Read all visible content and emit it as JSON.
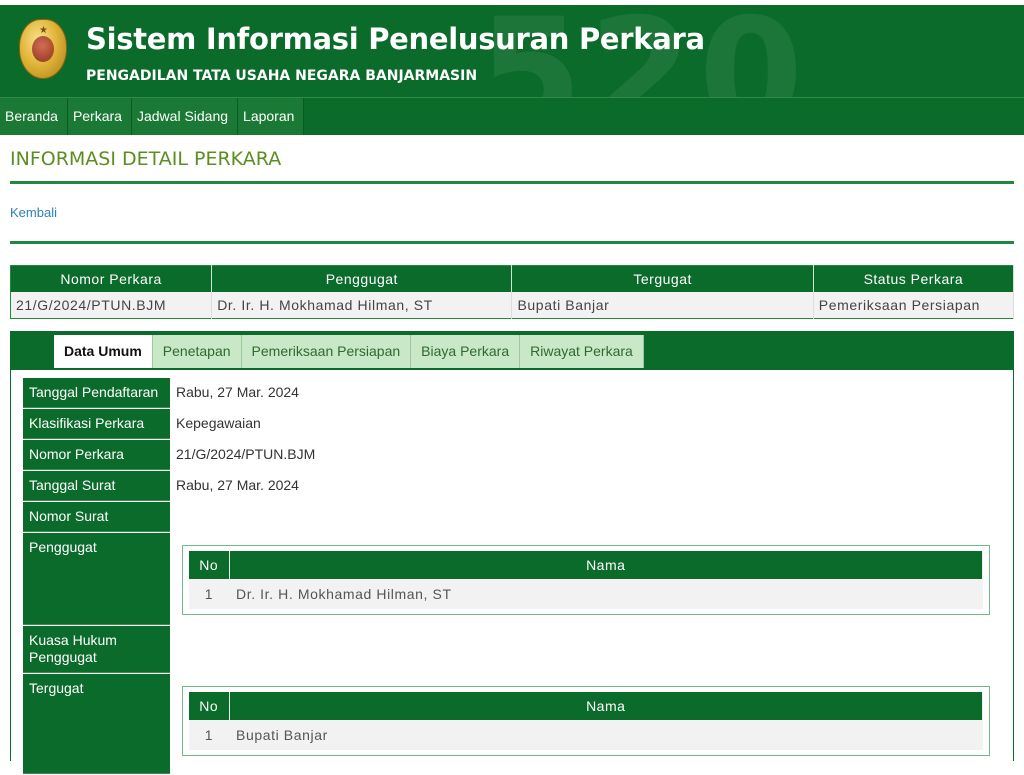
{
  "header": {
    "title": "Sistem Informasi Penelusuran Perkara",
    "subtitle": "PENGADILAN TATA USAHA NEGARA BANJARMASIN",
    "watermark": "520",
    "accent_color": "#0b6b2a"
  },
  "nav": {
    "items": [
      "Beranda",
      "Perkara",
      "Jadwal Sidang",
      "Laporan"
    ]
  },
  "page": {
    "title": "INFORMASI DETAIL PERKARA",
    "back_link": "Kembali"
  },
  "summary": {
    "headers": [
      "Nomor Perkara",
      "Penggugat",
      "Tergugat",
      "Status Perkara"
    ],
    "row": [
      "21/G/2024/PTUN.BJM",
      "Dr. Ir. H. Mokhamad Hilman, ST",
      "Bupati Banjar",
      "Pemeriksaan Persiapan"
    ]
  },
  "tabs": {
    "items": [
      "Data Umum",
      "Penetapan",
      "Pemeriksaan Persiapan",
      "Biaya Perkara",
      "Riwayat Perkara"
    ],
    "active": "Data Umum"
  },
  "detail": {
    "tanggal_pendaftaran": {
      "label": "Tanggal Pendaftaran",
      "value": "Rabu, 27 Mar. 2024"
    },
    "klasifikasi": {
      "label": "Klasifikasi Perkara",
      "value": "Kepegawaian"
    },
    "nomor_perkara": {
      "label": "Nomor Perkara",
      "value": "21/G/2024/PTUN.BJM"
    },
    "tanggal_surat": {
      "label": "Tanggal Surat",
      "value": "Rabu, 27 Mar. 2024"
    },
    "nomor_surat": {
      "label": "Nomor Surat",
      "value": ""
    },
    "penggugat": {
      "label": "Penggugat",
      "table": {
        "headers": [
          "No",
          "Nama"
        ],
        "rows": [
          {
            "no": "1",
            "nama": "Dr. Ir. H. Mokhamad Hilman, ST"
          }
        ]
      }
    },
    "kuasa_hukum": {
      "label": "Kuasa Hukum Penggugat",
      "value": ""
    },
    "tergugat": {
      "label": "Tergugat",
      "table": {
        "headers": [
          "No",
          "Nama"
        ],
        "rows": [
          {
            "no": "1",
            "nama": "Bupati Banjar"
          }
        ]
      }
    }
  }
}
